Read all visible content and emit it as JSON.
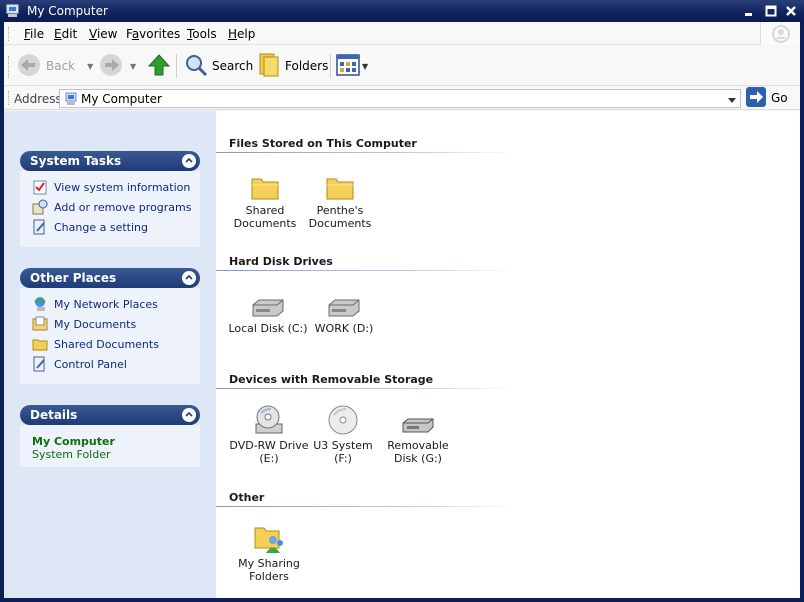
{
  "window": {
    "title": "My Computer"
  },
  "menu": {
    "items": [
      "File",
      "Edit",
      "View",
      "Favorites",
      "Tools",
      "Help"
    ],
    "underline": [
      "F",
      "E",
      "V",
      "a",
      "T",
      "H"
    ]
  },
  "toolbar": {
    "back": "Back",
    "search": "Search",
    "folders": "Folders"
  },
  "address": {
    "label": "Address",
    "value": "My Computer",
    "go": "Go"
  },
  "sidebar": {
    "system_tasks": {
      "title": "System Tasks",
      "items": [
        {
          "label": "View system information",
          "icon": "system-info-icon"
        },
        {
          "label": "Add or remove programs",
          "icon": "add-remove-programs-icon"
        },
        {
          "label": "Change a setting",
          "icon": "control-panel-icon"
        }
      ]
    },
    "other_places": {
      "title": "Other Places",
      "items": [
        {
          "label": "My Network Places",
          "icon": "network-places-icon"
        },
        {
          "label": "My Documents",
          "icon": "my-documents-icon"
        },
        {
          "label": "Shared Documents",
          "icon": "folder-icon"
        },
        {
          "label": "Control Panel",
          "icon": "control-panel-icon"
        }
      ]
    },
    "details": {
      "title": "Details",
      "name": "My Computer",
      "type": "System Folder"
    }
  },
  "groups": [
    {
      "title": "Files Stored on This Computer",
      "items": [
        {
          "line1": "Shared",
          "line2": "Documents",
          "icon": "folder-icon"
        },
        {
          "line1": "Penthe's",
          "line2": "Documents",
          "icon": "folder-icon"
        }
      ]
    },
    {
      "title": "Hard Disk Drives",
      "items": [
        {
          "line1": "Local Disk (C:)",
          "line2": "",
          "icon": "hard-disk-icon"
        },
        {
          "line1": "WORK (D:)",
          "line2": "",
          "icon": "hard-disk-icon"
        }
      ]
    },
    {
      "title": "Devices with Removable Storage",
      "items": [
        {
          "line1": "DVD-RW Drive",
          "line2": "(E:)",
          "icon": "dvd-drive-icon"
        },
        {
          "line1": "U3 System",
          "line2": "(F:)",
          "icon": "cd-icon"
        },
        {
          "line1": "Removable",
          "line2": "Disk (G:)",
          "icon": "removable-disk-icon"
        }
      ]
    },
    {
      "title": "Other",
      "items": [
        {
          "line1": "My Sharing",
          "line2": "Folders",
          "icon": "sharing-folders-icon"
        }
      ]
    }
  ],
  "colors": {
    "sidebar_bg": "#dee7f5",
    "header_blue": "#1e3c78",
    "link": "#0e2a7e",
    "details_green": "#0d6e0d"
  }
}
